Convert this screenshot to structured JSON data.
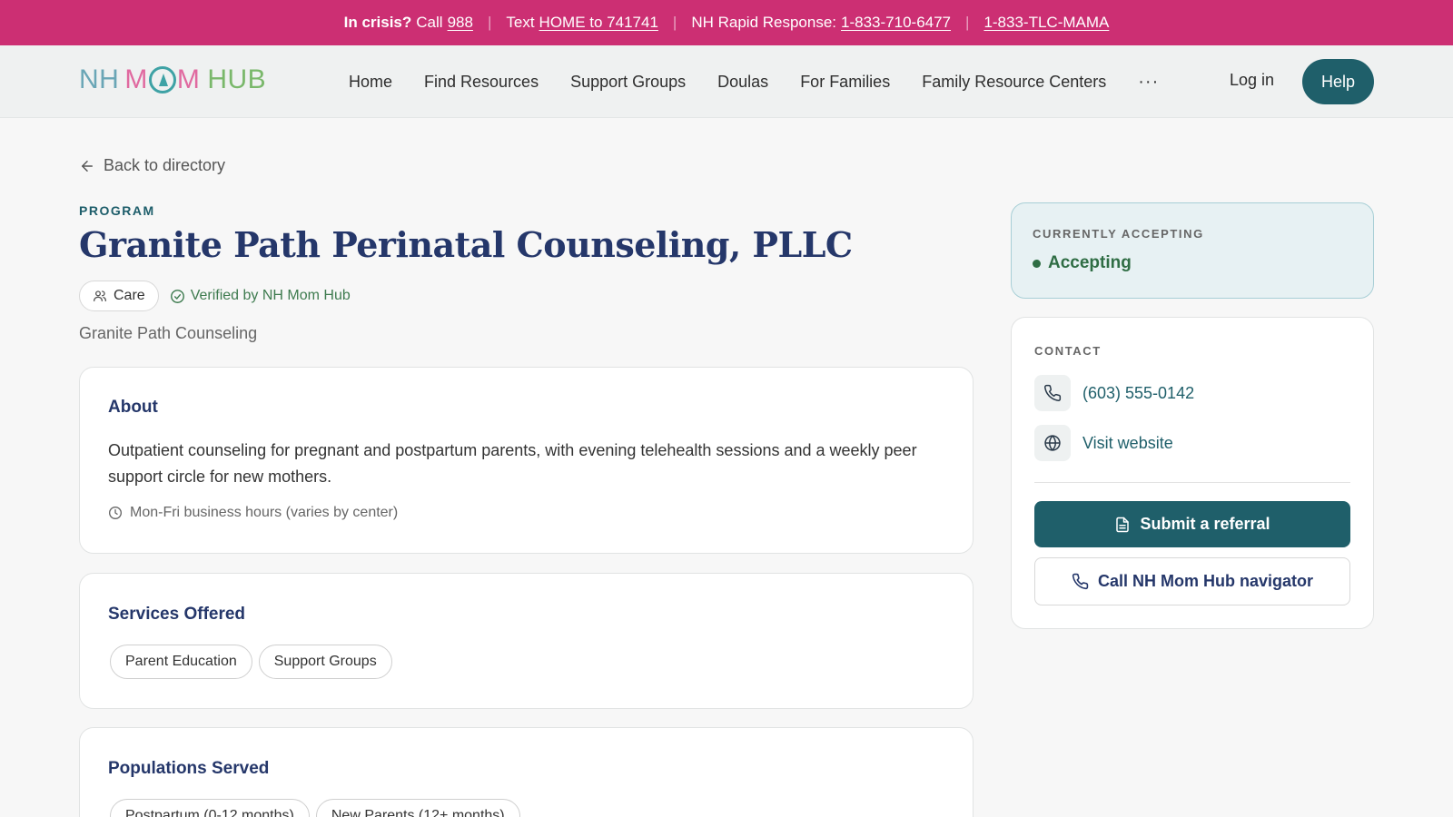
{
  "crisis_bar": {
    "prefix_bold": "In crisis?",
    "call_text": "Call",
    "call_number": "988",
    "text_label": "Text",
    "text_code": "HOME to 741741",
    "rapid_label": "NH Rapid Response:",
    "rapid_number": "1-833-710-6477",
    "tlc_number": "1-833-TLC-MAMA"
  },
  "nav": {
    "logo": {
      "nh": "NH",
      "mom_m1": "M",
      "mom_m2": "M",
      "hub": "HUB"
    },
    "links": [
      "Home",
      "Find Resources",
      "Support Groups",
      "Doulas",
      "For Families",
      "Family Resource Centers"
    ],
    "more": "···",
    "login": "Log in",
    "help": "Help"
  },
  "back_link": "Back to directory",
  "program": {
    "kicker": "PROGRAM",
    "title": "Granite Path Perinatal Counseling, PLLC",
    "category_chip": "Care",
    "verified": "Verified by NH Mom Hub",
    "organization": "Granite Path Counseling"
  },
  "about": {
    "heading": "About",
    "body": "Outpatient counseling for pregnant and postpartum parents, with evening telehealth sessions and a weekly peer support circle for new mothers.",
    "hours": "Mon-Fri business hours (varies by center)"
  },
  "services": {
    "heading": "Services Offered",
    "items": [
      "Parent Education",
      "Support Groups"
    ]
  },
  "populations": {
    "heading": "Populations Served",
    "items": [
      "Postpartum (0-12 months)",
      "New Parents (12+ months)"
    ]
  },
  "status": {
    "label": "CURRENTLY ACCEPTING",
    "value": "Accepting"
  },
  "contact": {
    "label": "CONTACT",
    "phone": "(603) 555-0142",
    "website": "Visit website",
    "referral_button": "Submit a referral",
    "navigator_button": "Call NH Mom Hub navigator"
  },
  "icons": {
    "back": "arrow-left-icon",
    "care": "people-icon",
    "verified": "check-circle-icon",
    "hours": "clock-icon",
    "phone": "phone-icon",
    "website": "globe-icon",
    "referral": "document-icon",
    "navigator": "phone-icon"
  },
  "colors": {
    "crisis_bar": "#cc2f73",
    "primary": "#1f5f6a",
    "heading": "#25376a",
    "accepting": "#2f6d44"
  }
}
